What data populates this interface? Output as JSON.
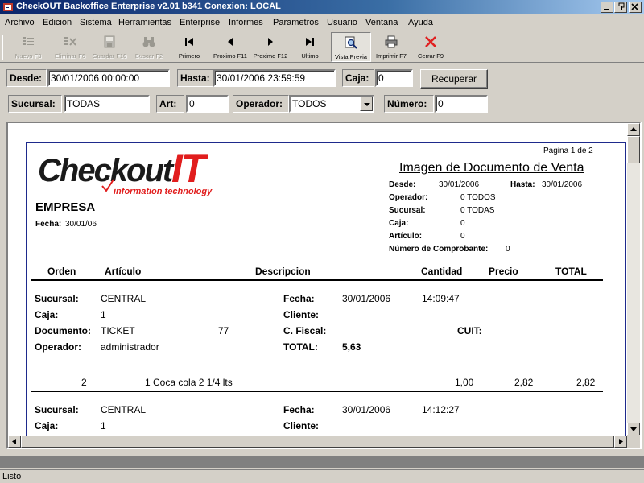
{
  "window": {
    "title": "CheckOUT Backoffice Enterprise v2.01 b341 Conexion: LOCAL"
  },
  "menu": [
    "Archivo",
    "Edicion",
    "Sistema",
    "Herramientas",
    "Enterprise",
    "Informes",
    "Parametros",
    "Usuario",
    "Ventana",
    "Ayuda"
  ],
  "toolbar": {
    "nuevo": "Nuevo F3",
    "eliminar": "Eliminar F6",
    "guardar": "Guardar F10",
    "buscar": "Buscar F2",
    "primero": "Primero",
    "proximo_f11": "Proximo F11",
    "proximo_f12": "Proximo F12",
    "ultimo": "Ultimo",
    "vista_previa": "Vista Previa",
    "imprimir": "Imprimir F7",
    "cerrar": "Cerrar F9"
  },
  "filters": {
    "desde_label": "Desde:",
    "desde_value": "30/01/2006 00:00:00",
    "hasta_label": "Hasta:",
    "hasta_value": "30/01/2006 23:59:59",
    "caja_label": "Caja:",
    "caja_value": "0",
    "recuperar": "Recuperar",
    "sucursal_label": "Sucursal:",
    "sucursal_value": "TODAS",
    "art_label": "Art:",
    "art_value": "0",
    "operador_label": "Operador:",
    "operador_value": "TODOS",
    "numero_label": "Número:",
    "numero_value": "0"
  },
  "report": {
    "page_indicator": "Pagina 1 de 2",
    "logo_main": "Checkout",
    "logo_it": "IT",
    "logo_tagline": "information technology",
    "title": "Imagen de Documento de Venta",
    "company": "EMPRESA",
    "fecha_label": "Fecha:",
    "fecha_value": "30/01/06",
    "meta": {
      "desde_label": "Desde:",
      "desde_value": "30/01/2006",
      "hasta_label": "Hasta:",
      "hasta_value": "30/01/2006",
      "operador_label": "Operador:",
      "operador_value": "0 TODOS",
      "sucursal_label": "Sucursal:",
      "sucursal_value": "0 TODAS",
      "caja_label": "Caja:",
      "caja_value": "0",
      "articulo_label": "Artículo:",
      "articulo_value": "0",
      "comprobante_label": "Número de Comprobante:",
      "comprobante_value": "0"
    },
    "columns": {
      "orden": "Orden",
      "articulo": "Artículo",
      "descripcion": "Descripcion",
      "cantidad": "Cantidad",
      "precio": "Precio",
      "total": "TOTAL"
    },
    "doc1": {
      "sucursal_label": "Sucursal:",
      "sucursal": "CENTRAL",
      "fecha_label": "Fecha:",
      "fecha": "30/01/2006",
      "hora": "14:09:47",
      "caja_label": "Caja:",
      "caja": "1",
      "cliente_label": "Cliente:",
      "documento_label": "Documento:",
      "documento": "TICKET",
      "doc_numero": "77",
      "cfiscal_label": "C. Fiscal:",
      "cuit_label": "CUIT:",
      "operador_label": "Operador:",
      "operador": "administrador",
      "total_label": "TOTAL:",
      "total": "5,63",
      "line": {
        "orden": "2",
        "descripcion": "1 Coca cola 2 1/4 lts",
        "cantidad": "1,00",
        "precio": "2,82",
        "total": "2,82"
      }
    },
    "doc2": {
      "sucursal_label": "Sucursal:",
      "sucursal": "CENTRAL",
      "fecha_label": "Fecha:",
      "fecha": "30/01/2006",
      "hora": "14:12:27",
      "caja_label": "Caja:",
      "caja": "1",
      "cliente_label": "Cliente:"
    }
  },
  "status": {
    "text": "Listo"
  }
}
